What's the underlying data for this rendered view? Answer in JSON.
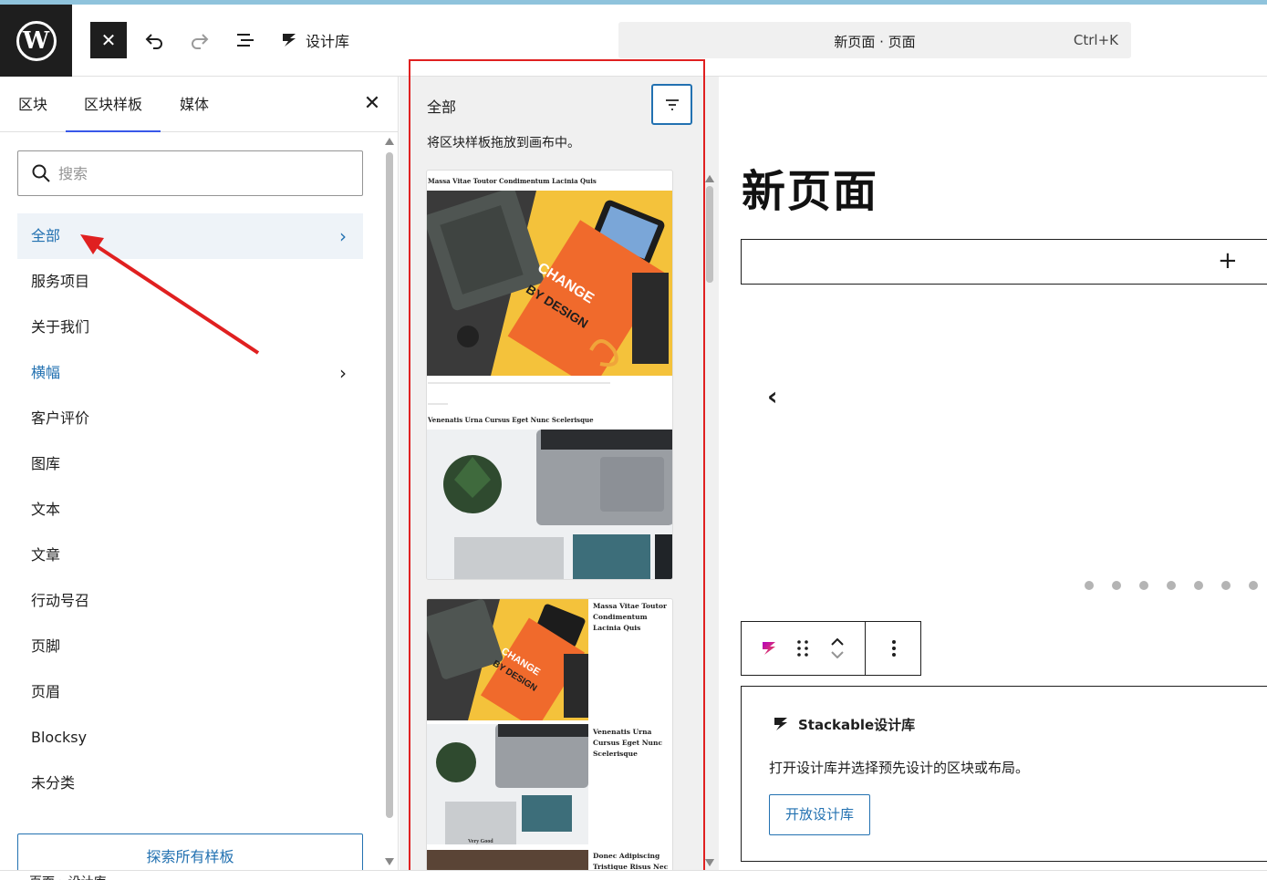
{
  "topbar": {
    "library_label": "设计库",
    "doc_title": "新页面 · 页面",
    "shortcut": "Ctrl+K"
  },
  "inserter": {
    "tabs": [
      "区块",
      "区块样板",
      "媒体"
    ],
    "active_tab": "区块样板",
    "search_placeholder": "搜索",
    "categories": [
      {
        "label": "全部",
        "active": true,
        "has_chevron": true
      },
      {
        "label": "服务项目"
      },
      {
        "label": "关于我们"
      },
      {
        "label": "横幅",
        "has_chevron": true
      },
      {
        "label": "客户评价"
      },
      {
        "label": "图库"
      },
      {
        "label": "文本"
      },
      {
        "label": "文章"
      },
      {
        "label": "行动号召"
      },
      {
        "label": "页脚"
      },
      {
        "label": "页眉"
      },
      {
        "label": "Blocksy"
      },
      {
        "label": "未分类"
      }
    ],
    "explore_button": "探索所有样板"
  },
  "patterns": {
    "title": "全部",
    "description": "将区块样板拖放到画布中。",
    "card1": {
      "heading1": "Massa Vitae Toutor Condimentum Lacinia Quis",
      "heading2": "Venenatis Urna Cursus Eget Nunc Scelerisque",
      "book_text1": "CHANGE",
      "book_text2": "BY DESIGN"
    },
    "card2": {
      "heading1": "Massa Vitae Toutor Condimentum Lacinia Quis",
      "heading2": "Venenatis Urna Cursus Eget Nunc Scelerisque",
      "heading3": "Donec Adipiscing Tristique Risus Nec",
      "book_text1": "CHANGE",
      "book_text2": "BY DESIGN",
      "caption": "Very Good"
    }
  },
  "canvas": {
    "page_title": "新页面",
    "stackable": {
      "title": "Stackable设计库",
      "description": "打开设计库并选择预先设计的区块或布局。",
      "button": "开放设计库"
    }
  },
  "footer": {
    "breadcrumb": "页面  ›  设计库"
  },
  "colors": {
    "accent": "#2271b1",
    "annotation": "#e02020",
    "dark": "#1e1e1e"
  }
}
